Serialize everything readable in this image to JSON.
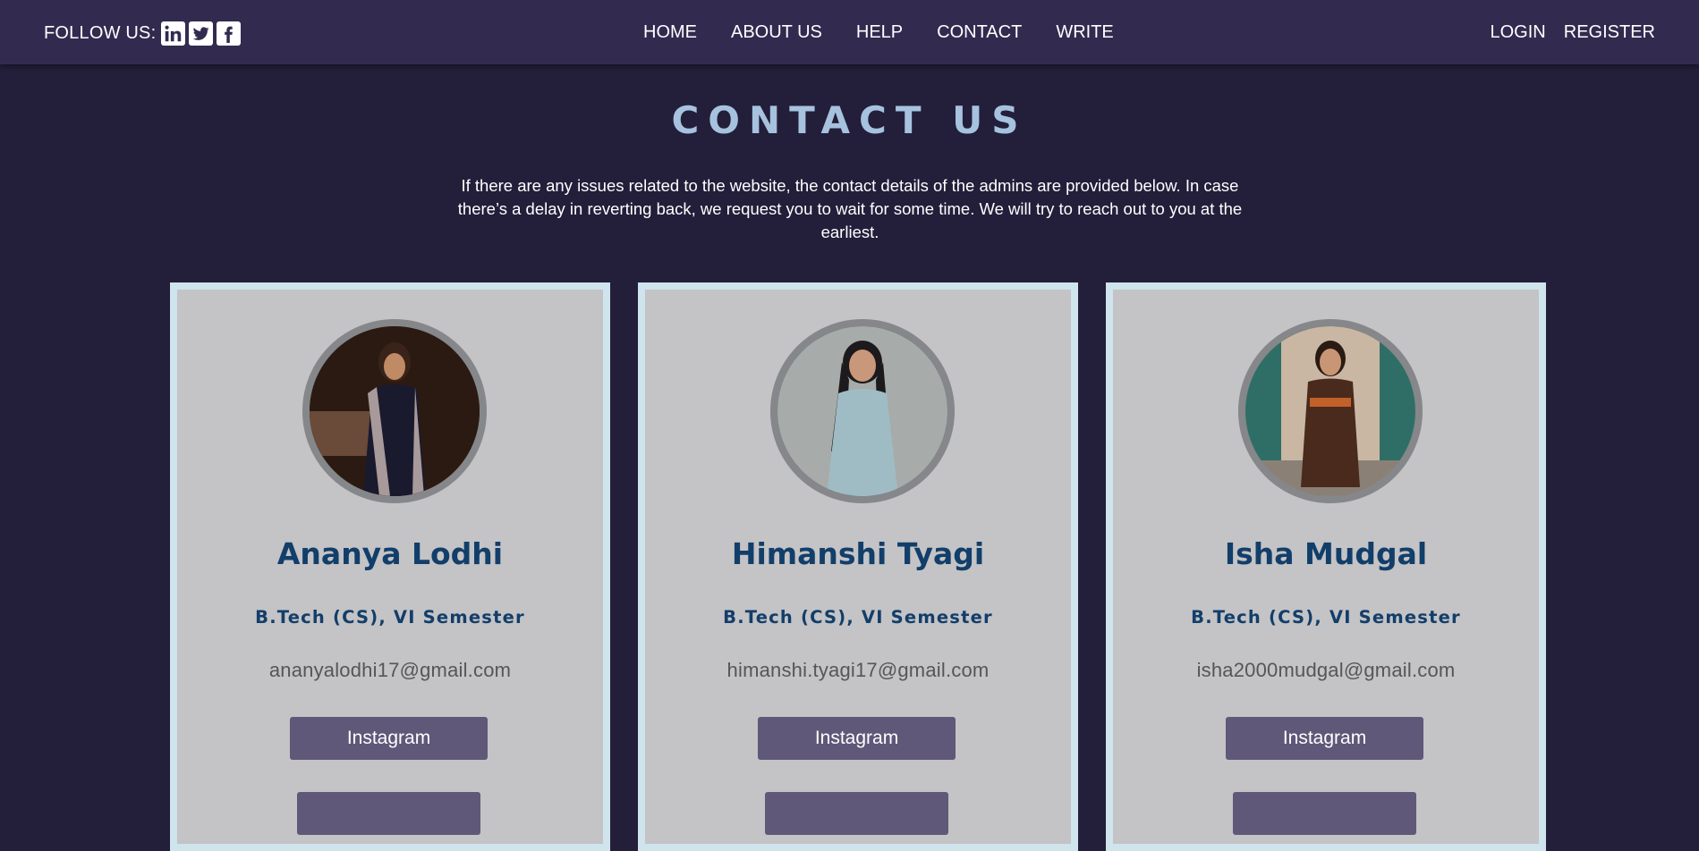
{
  "header": {
    "follow_label": "FOLLOW US:",
    "social_icons": [
      "linkedin-icon",
      "twitter-icon",
      "facebook-icon"
    ],
    "nav": [
      "HOME",
      "ABOUT US",
      "HELP",
      "CONTACT",
      "WRITE"
    ],
    "auth": [
      "LOGIN",
      "REGISTER"
    ]
  },
  "main": {
    "title": "CONTACT US",
    "intro": "If there are any issues related to the website, the contact details of the admins are provided below. In case there’s a delay in reverting back, we request you to wait for some time. We will try to reach out to you at the earliest."
  },
  "cards": [
    {
      "name": "Ananya Lodhi",
      "degree": "B.Tech (CS), VI Semester",
      "email": "ananyalodhi17@gmail.com",
      "button": "Instagram"
    },
    {
      "name": "Himanshi Tyagi",
      "degree": "B.Tech (CS), VI Semester",
      "email": "himanshi.tyagi17@gmail.com",
      "button": "Instagram"
    },
    {
      "name": "Isha Mudgal",
      "degree": "B.Tech (CS), VI Semester",
      "email": "isha2000mudgal@gmail.com",
      "button": "Instagram"
    }
  ],
  "colors": {
    "background": "#231e3a",
    "header": "#322b4f",
    "title": "#a6c2de",
    "card": "#c4c3c5",
    "card_border": "#cfe4ec",
    "name": "#123e6a",
    "button": "#5f5879"
  }
}
